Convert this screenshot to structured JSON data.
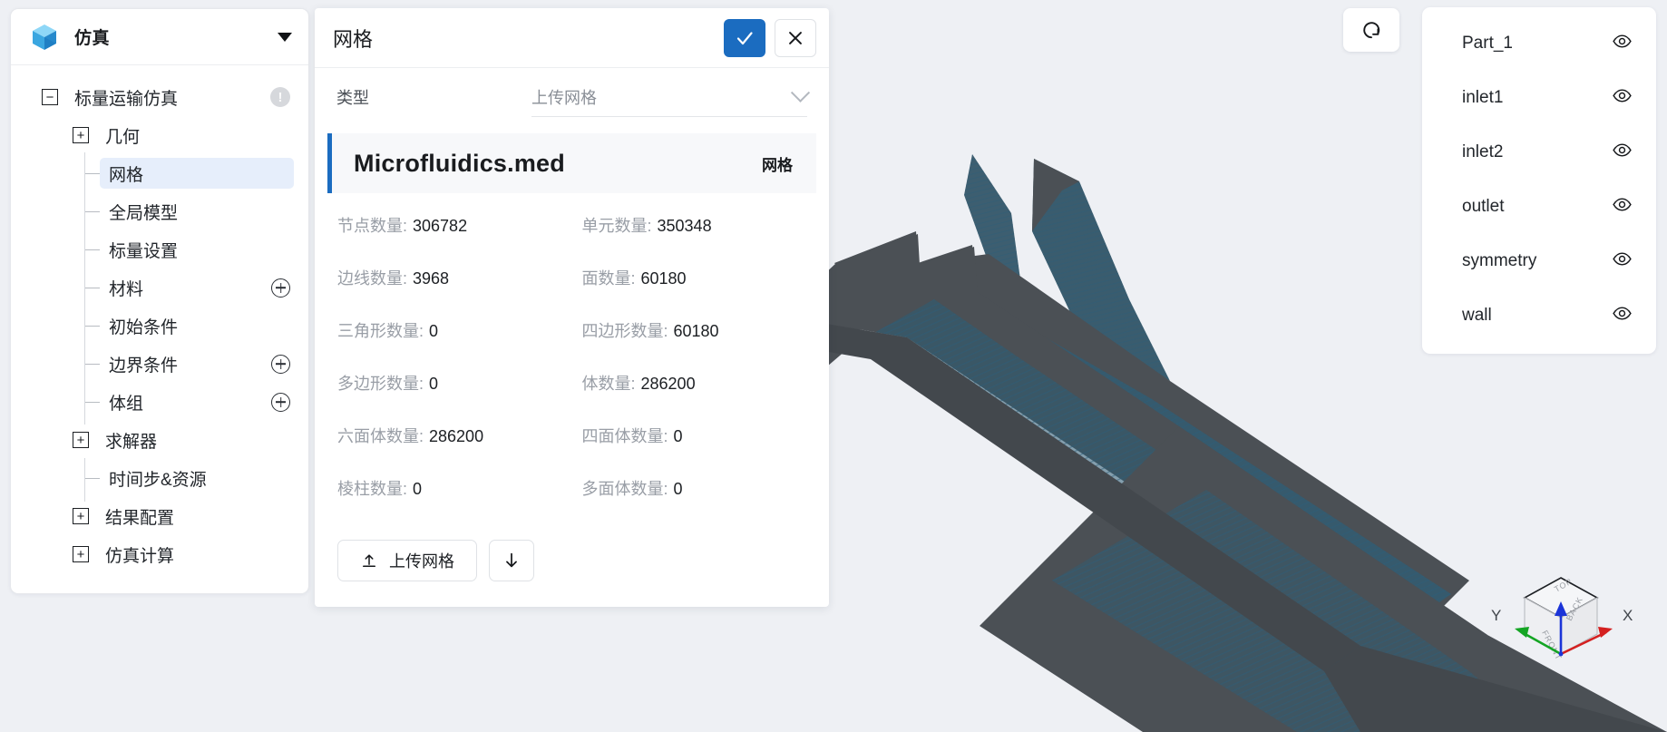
{
  "app": {
    "title": "仿真",
    "logo_icon": "cube-logo-icon",
    "caret_icon": "chevron-down-icon"
  },
  "sidebar": {
    "tree": [
      {
        "label": "标量运输仿真",
        "expander": "minus",
        "depth": 0,
        "badge": "!",
        "selected": false
      },
      {
        "label": "几何",
        "expander": "plus",
        "depth": 1,
        "selected": false
      },
      {
        "label": "网格",
        "expander": "dash",
        "depth": 2,
        "selected": true
      },
      {
        "label": "全局模型",
        "expander": "dash",
        "depth": 2,
        "selected": false
      },
      {
        "label": "标量设置",
        "expander": "dash",
        "depth": 2,
        "selected": false
      },
      {
        "label": "材料",
        "expander": "dash",
        "depth": 2,
        "selected": false,
        "add": true
      },
      {
        "label": "初始条件",
        "expander": "dash",
        "depth": 2,
        "selected": false
      },
      {
        "label": "边界条件",
        "expander": "dash",
        "depth": 2,
        "selected": false,
        "add": true
      },
      {
        "label": "体组",
        "expander": "dash",
        "depth": 2,
        "selected": false,
        "add": true
      },
      {
        "label": "求解器",
        "expander": "plus",
        "depth": 1,
        "selected": false
      },
      {
        "label": "时间步&资源",
        "expander": "dash",
        "depth": 2,
        "selected": false
      },
      {
        "label": "结果配置",
        "expander": "plus",
        "depth": 1,
        "selected": false
      },
      {
        "label": "仿真计算",
        "expander": "plus",
        "depth": 1,
        "selected": false
      }
    ]
  },
  "dialog": {
    "title": "网格",
    "confirm_icon": "check-icon",
    "cancel_icon": "close-icon",
    "type_label": "类型",
    "type_value": "上传网格",
    "type_chevron_icon": "chevron-down-icon",
    "file": {
      "name": "Microfluidics.med",
      "kind": "网格"
    },
    "stats": [
      {
        "key": "节点数量:",
        "value": "306782"
      },
      {
        "key": "单元数量:",
        "value": "350348"
      },
      {
        "key": "边线数量:",
        "value": "3968"
      },
      {
        "key": "面数量:",
        "value": "60180"
      },
      {
        "key": "三角形数量:",
        "value": "0"
      },
      {
        "key": "四边形数量:",
        "value": "60180"
      },
      {
        "key": "多边形数量:",
        "value": "0"
      },
      {
        "key": "体数量:",
        "value": "286200"
      },
      {
        "key": "六面体数量:",
        "value": "286200"
      },
      {
        "key": "四面体数量:",
        "value": "0"
      },
      {
        "key": "棱柱数量:",
        "value": "0"
      },
      {
        "key": "多面体数量:",
        "value": "0"
      }
    ],
    "upload_button": "上传网格",
    "upload_icon": "upload-icon",
    "download_icon": "download-arrow-icon"
  },
  "parts_panel": {
    "items": [
      {
        "name": "Part_1",
        "visibility_icon": "eye-icon"
      },
      {
        "name": "inlet1",
        "visibility_icon": "eye-icon"
      },
      {
        "name": "inlet2",
        "visibility_icon": "eye-icon"
      },
      {
        "name": "outlet",
        "visibility_icon": "eye-icon"
      },
      {
        "name": "symmetry",
        "visibility_icon": "eye-icon"
      },
      {
        "name": "wall",
        "visibility_icon": "eye-icon"
      }
    ]
  },
  "viewport": {
    "reset_icon": "reset-view-icon",
    "gizmo": {
      "x_label": "X",
      "y_label": "Y",
      "face_front": "FRONT",
      "face_top": "TOP",
      "face_back": "BACK",
      "x_color": "#d42020",
      "y_color": "#14a524",
      "z_color": "#1b34d8"
    }
  },
  "colors": {
    "accent": "#1b6cc0",
    "page_bg": "#eef0f4",
    "panel_bg": "#ffffff",
    "model_gray": "#4b5055",
    "model_blue": "#2c5a72",
    "selected_row": "#e6eefb"
  }
}
